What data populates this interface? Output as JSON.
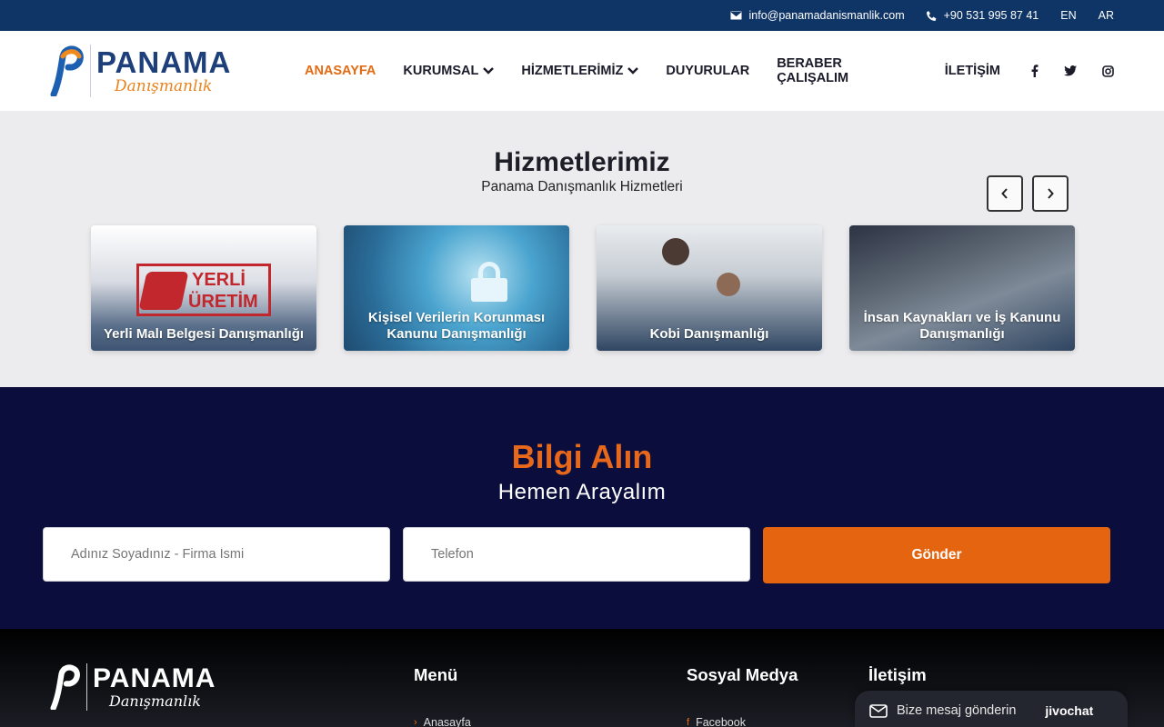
{
  "topbar": {
    "email": "info@panamadanismanlik.com",
    "phone": "+90 531 995 87 41",
    "lang_en": "EN",
    "lang_ar": "AR"
  },
  "logo": {
    "title": "PANAMA",
    "subtitle": "Danışmanlık"
  },
  "nav": {
    "home": "ANASAYFA",
    "corporate": "KURUMSAL",
    "services": "HİZMETLERİMİZ",
    "announcements": "DUYURULAR",
    "work_together": "BERABER ÇALIŞALIM",
    "contact": "İLETİŞİM"
  },
  "services_section": {
    "heading": "Hizmetlerimiz",
    "subheading": "Panama Danışmanlık Hizmetleri",
    "cards": [
      {
        "title": "Yerli Malı Belgesi Danışmanlığı"
      },
      {
        "title": "Kişisel Verilerin Korunması Kanunu Danışmanlığı"
      },
      {
        "title": "Kobi Danışmanlığı"
      },
      {
        "title": "İnsan Kaynakları ve İş Kanunu Danışmanlığı"
      }
    ],
    "card1_logo_line1": "YERLİ",
    "card1_logo_line2": "ÜRETİM"
  },
  "contact_form": {
    "heading": "Bilgi Alın",
    "subheading": "Hemen Arayalım",
    "name_placeholder": "Adınız Soyadınız - Firma İsmi",
    "phone_placeholder": "Telefon",
    "submit_label": "Gönder"
  },
  "footer": {
    "menu_title": "Menü",
    "social_title": "Sosyal Medya",
    "contact_title": "İletişim",
    "menu_link": "Anasayfa",
    "social_link": "Facebook"
  },
  "chat": {
    "label": "Bize mesaj gönderin",
    "brand": "jivochat"
  },
  "colors": {
    "topbar": "#0f3466",
    "accent": "#e5640f",
    "dark_section": "#0b0e3c",
    "brand_blue": "#1d3f7a"
  }
}
